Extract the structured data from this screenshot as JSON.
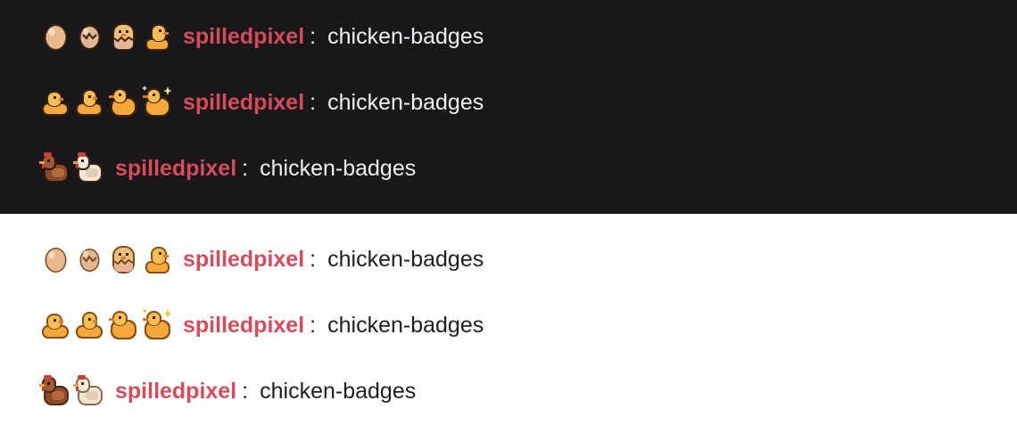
{
  "chat": {
    "dark_theme": {
      "background": "#18181b",
      "lines": [
        {
          "badges": [
            "egg-badge",
            "cracked-egg-badge",
            "hatching-chick-badge",
            "chick-badge"
          ],
          "username": "spilledpixel",
          "separator": ":",
          "message": "chicken-badges"
        },
        {
          "badges": [
            "chick-badge",
            "chick-badge",
            "chick-badge",
            "sparkle-chick-badge"
          ],
          "username": "spilledpixel",
          "separator": ":",
          "message": "chicken-badges"
        },
        {
          "badges": [
            "brown-hen-badge",
            "white-hen-badge"
          ],
          "username": "spilledpixel",
          "separator": ":",
          "message": "chicken-badges"
        }
      ]
    },
    "light_theme": {
      "background": "#ffffff",
      "lines": [
        {
          "badges": [
            "egg-badge",
            "cracked-egg-badge",
            "hatching-chick-badge",
            "chick-badge"
          ],
          "username": "spilledpixel",
          "separator": ":",
          "message": "chicken-badges"
        },
        {
          "badges": [
            "chick-badge",
            "chick-badge",
            "chick-badge",
            "sparkle-chick-badge"
          ],
          "username": "spilledpixel",
          "separator": ":",
          "message": "chicken-badges"
        },
        {
          "badges": [
            "brown-hen-badge",
            "white-hen-badge"
          ],
          "username": "spilledpixel",
          "separator": ":",
          "message": "chicken-badges"
        }
      ]
    },
    "username_color": "#d94b5a"
  }
}
